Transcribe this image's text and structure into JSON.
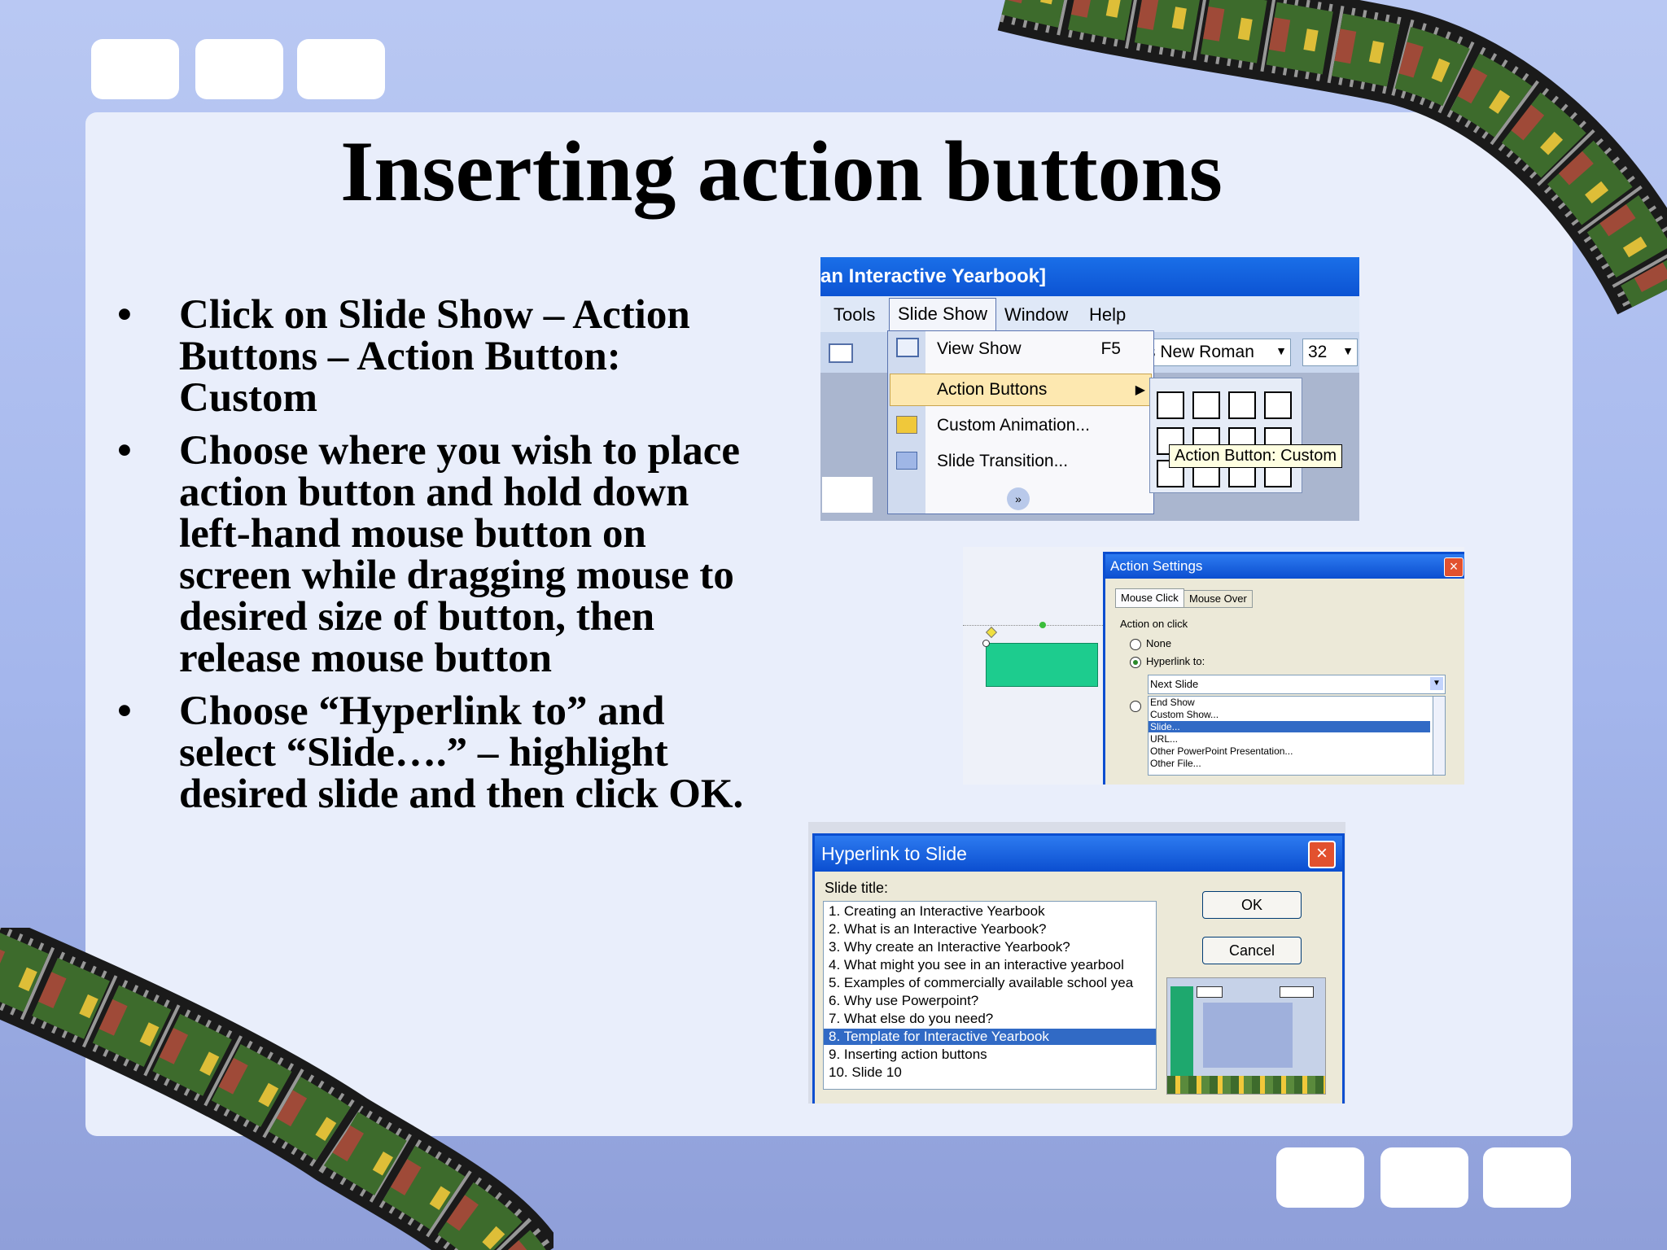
{
  "slide": {
    "title": "Inserting action buttons",
    "bullet_char": "•",
    "bullets": [
      "Click on Slide Show – Action Buttons – Action Button: Custom",
      "Choose where you wish to place action button and hold down left-hand mouse button on screen while dragging mouse to desired size of button, then release mouse button",
      "Choose “Hyperlink to” and select “Slide….” – highlight desired slide and then click OK."
    ]
  },
  "menu_shot": {
    "window_title": "an Interactive Yearbook]",
    "menubar": [
      "Tools",
      "Slide Show",
      "Window",
      "Help"
    ],
    "font_name": "s New Roman",
    "font_size": "32",
    "menu_items": {
      "view_show": "View Show",
      "view_show_key": "F5",
      "action_buttons": "Action Buttons",
      "custom_animation": "Custom Animation...",
      "slide_transition": "Slide Transition..."
    },
    "tooltip": "Action Button: Custom"
  },
  "action_settings": {
    "title": "Action Settings",
    "tabs": [
      "Mouse Click",
      "Mouse Over"
    ],
    "group_label": "Action on click",
    "none_label": "None",
    "hyperlink_label": "Hyperlink to:",
    "selected": "Next Slide",
    "options": [
      "End Show",
      "Custom Show...",
      "Slide...",
      "URL...",
      "Other PowerPoint Presentation...",
      "Other File..."
    ],
    "highlighted_option": "Slide..."
  },
  "hyperlink_dialog": {
    "title": "Hyperlink to Slide",
    "list_label": "Slide title:",
    "ok": "OK",
    "cancel": "Cancel",
    "slides": [
      "1. Creating an Interactive Yearbook",
      "2. What is an Interactive Yearbook?",
      "3. Why create an Interactive Yearbook?",
      "4. What might you see in an interactive yearbool",
      "5. Examples of commercially available school yea",
      "6. Why use Powerpoint?",
      "7. What else do you need?",
      "8. Template for  Interactive Yearbook",
      "9. Inserting action buttons",
      "10. Slide 10"
    ],
    "selected_index": 7
  },
  "colors": {
    "selection": "#316ac5",
    "action_button_fill": "#1dcc8e",
    "title_bar": "#0b4ed0"
  }
}
